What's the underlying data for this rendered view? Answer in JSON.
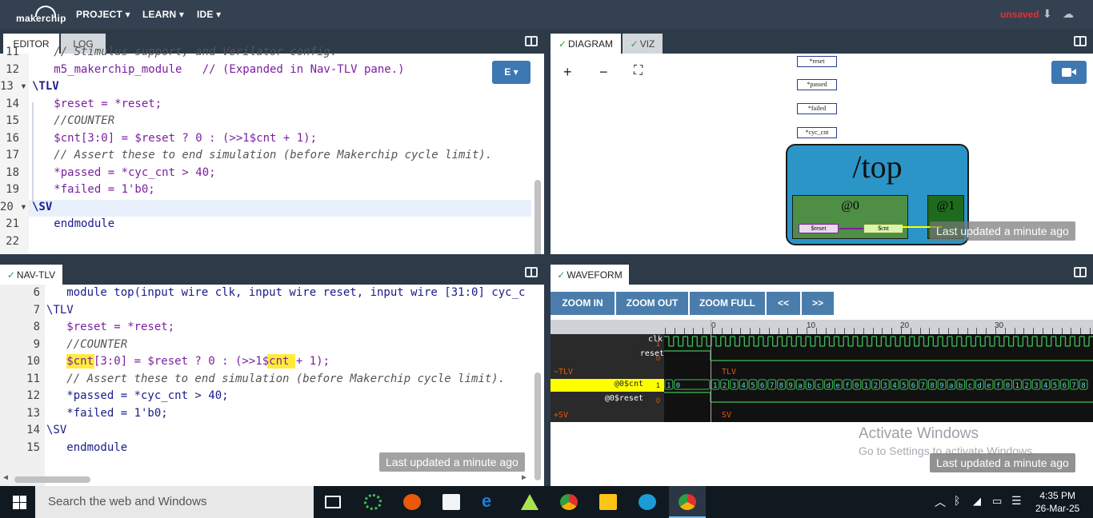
{
  "app": {
    "logo": "makerchip",
    "menu": [
      "PROJECT ▾",
      "LEARN ▾",
      "IDE ▾"
    ],
    "status": "unsaved"
  },
  "editor": {
    "tabs": [
      "EDITOR",
      "LOG"
    ],
    "button": "E ▾",
    "badge": "",
    "lines": [
      {
        "n": "11",
        "text": "   // Stimulus support, and Verilator config."
      },
      {
        "n": "12",
        "text": "   m5_makerchip_module   // (Expanded in Nav-TLV pane.)"
      },
      {
        "n": "13 ▾",
        "text": "\\TLV"
      },
      {
        "n": "14",
        "text": "   $reset = *reset;"
      },
      {
        "n": "15",
        "text": "   //COUNTER"
      },
      {
        "n": "16",
        "text": "   $cnt[3:0] = $reset ? 0 : (>>1$cnt + 1);"
      },
      {
        "n": "17",
        "text": "   // Assert these to end simulation (before Makerchip cycle limit)."
      },
      {
        "n": "18",
        "text": "   *passed = *cyc_cnt > 40;"
      },
      {
        "n": "19",
        "text": "   *failed = 1'b0;"
      },
      {
        "n": "20 ▾",
        "text": "\\SV"
      },
      {
        "n": "21",
        "text": "   endmodule"
      },
      {
        "n": "22",
        "text": ""
      }
    ]
  },
  "navtlv": {
    "tab": "NAV-TLV",
    "badge": "Last updated a minute ago",
    "lines": [
      {
        "n": "6",
        "text": "   module top(input wire clk, input wire reset, input wire [31:0] cyc_c"
      },
      {
        "n": "7",
        "text": "\\TLV"
      },
      {
        "n": "8",
        "text": "   $reset = *reset;"
      },
      {
        "n": "9",
        "text": "   //COUNTER"
      },
      {
        "n": "10",
        "text": "   $cnt[3:0] = $reset ? 0 : (>>1$cnt + 1);"
      },
      {
        "n": "11",
        "text": "   // Assert these to end simulation (before Makerchip cycle limit)."
      },
      {
        "n": "12",
        "text": "   *passed = *cyc_cnt > 40;"
      },
      {
        "n": "13",
        "text": "   *failed = 1'b0;"
      },
      {
        "n": "14",
        "text": "\\SV"
      },
      {
        "n": "15",
        "text": "   endmodule"
      }
    ]
  },
  "diagram": {
    "tabs": [
      "DIAGRAM",
      "VIZ"
    ],
    "controls": [
      "+",
      "−",
      "⛶"
    ],
    "signals": [
      "*reset",
      "*passed",
      "*failed",
      "*cyc_cnt"
    ],
    "top_label": "/top",
    "stage0": "@0",
    "stage1": "@1",
    "node_reset": "$reset",
    "node_cnt": "$cnt",
    "badge": "Last updated a minute ago"
  },
  "waveform": {
    "tab": "WAVEFORM",
    "buttons": [
      "ZOOM IN",
      "ZOOM OUT",
      "ZOOM FULL",
      "<<",
      ">>"
    ],
    "ruler": [
      "0",
      "10",
      "20",
      "30"
    ],
    "rows": [
      {
        "name": "clk",
        "val": "1"
      },
      {
        "name": "reset",
        "val": "0"
      },
      {
        "name": "−TLV",
        "val": "",
        "group": "TLV"
      },
      {
        "name": "@0$cnt",
        "val": "1"
      },
      {
        "name": "@0$reset",
        "val": "0"
      },
      {
        "name": "+SV",
        "val": "",
        "group": "SV"
      }
    ],
    "cnt_values": [
      "1",
      "0",
      "1",
      "2",
      "3",
      "4",
      "5",
      "6",
      "7",
      "8",
      "9",
      "a",
      "b",
      "c",
      "d",
      "e",
      "f",
      "0",
      "1",
      "2",
      "3",
      "4",
      "5",
      "6",
      "7",
      "8",
      "9",
      "a",
      "b",
      "c",
      "d",
      "e",
      "f",
      "0",
      "1",
      "2",
      "3",
      "4",
      "5",
      "6",
      "7",
      "8"
    ],
    "badge": "Last updated a minute ago"
  },
  "os": {
    "activate_title": "Activate Windows",
    "activate_sub": "Go to Settings to activate Windows.",
    "search": "Search the web and Windows",
    "time": "4:35 PM",
    "date": "26-Mar-25"
  }
}
